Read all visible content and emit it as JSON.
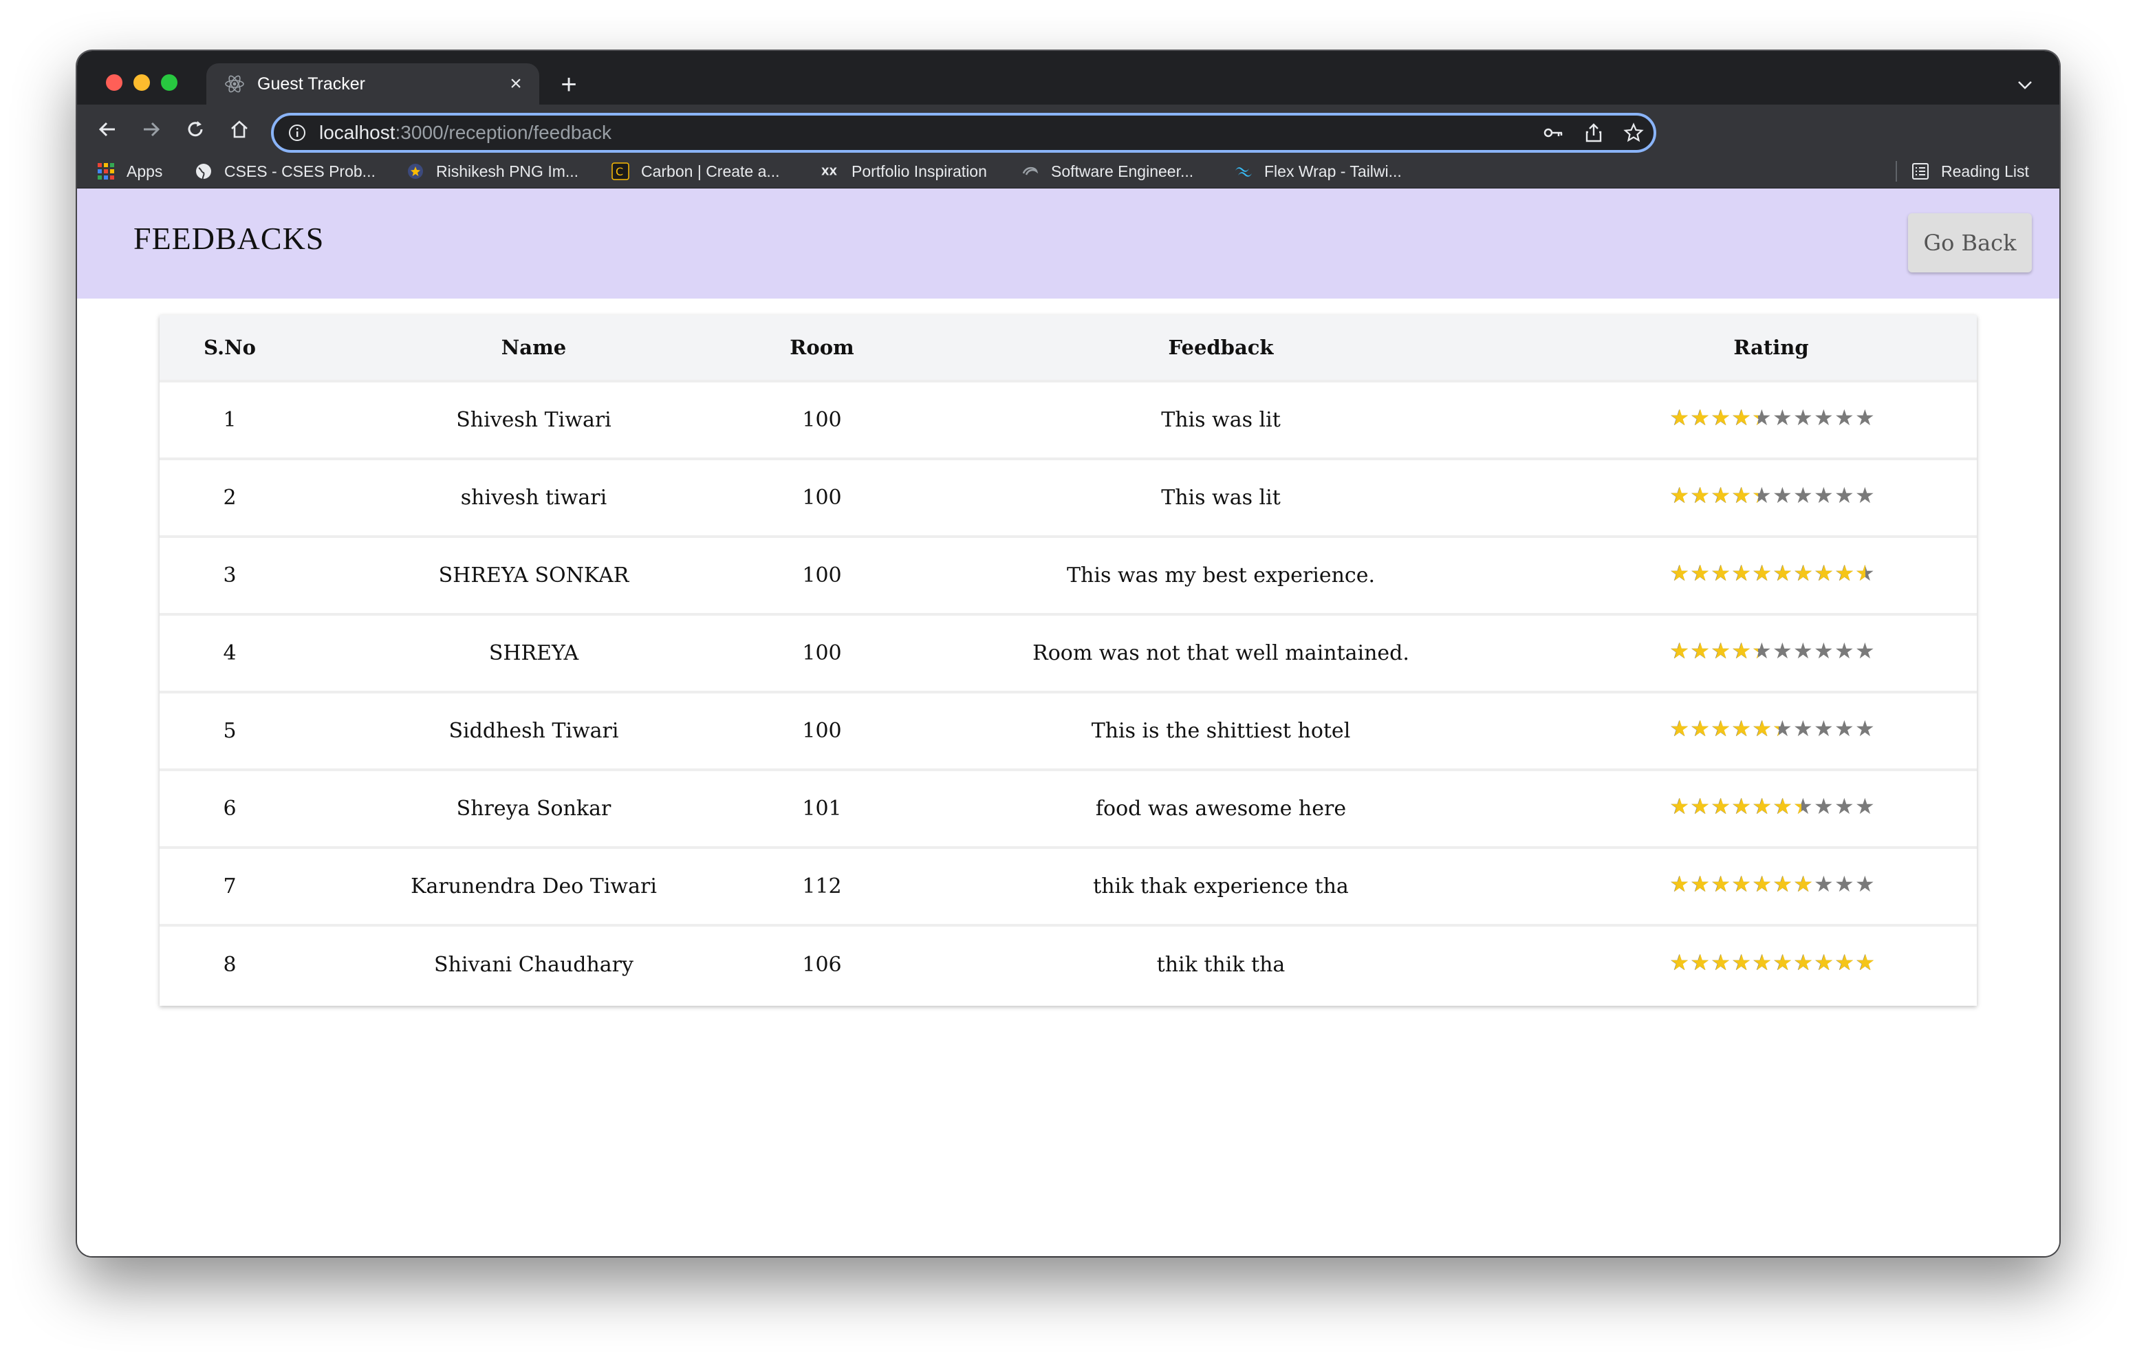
{
  "browser": {
    "tab_title": "Guest Tracker",
    "url_host": "localhost",
    "url_rest": ":3000/reception/feedback",
    "bookmarks": [
      "Apps",
      "CSES - CSES Prob...",
      "Rishikesh PNG Im...",
      "Carbon | Create a...",
      "Portfolio Inspiration",
      "Software Engineer...",
      "Flex Wrap - Tailwi..."
    ],
    "reading_list": "Reading List",
    "ext_badge": "Off"
  },
  "page": {
    "title": "FEEDBACKS",
    "go_back_label": "Go Back"
  },
  "table": {
    "headers": [
      "S.No",
      "Name",
      "Room",
      "Feedback",
      "Rating"
    ],
    "rows": [
      {
        "sno": "1",
        "name": "Shivesh Tiwari",
        "room": "100",
        "feedback": "This was lit",
        "rating": 4.3
      },
      {
        "sno": "2",
        "name": "shivesh tiwari",
        "room": "100",
        "feedback": "This was lit",
        "rating": 4.3
      },
      {
        "sno": "3",
        "name": "SHREYA SONKAR",
        "room": "100",
        "feedback": "This was my best experience.",
        "rating": 9.5
      },
      {
        "sno": "4",
        "name": "SHREYA",
        "room": "100",
        "feedback": "Room was not that well maintained.",
        "rating": 4.3
      },
      {
        "sno": "5",
        "name": "Siddhesh Tiwari",
        "room": "100",
        "feedback": "This is the shittiest hotel",
        "rating": 5.3
      },
      {
        "sno": "6",
        "name": "Shreya Sonkar",
        "room": "101",
        "feedback": "food was awesome here",
        "rating": 6.4
      },
      {
        "sno": "7",
        "name": "Karunendra Deo Tiwari",
        "room": "112",
        "feedback": "thik thak experience tha",
        "rating": 7
      },
      {
        "sno": "8",
        "name": "Shivani Chaudhary",
        "room": "106",
        "feedback": "thik thik tha",
        "rating": 10
      }
    ],
    "rating_max": 10
  },
  "colors": {
    "header_bg": "#dcd5f8",
    "star_filled": "#f5c518",
    "star_empty": "#7a7a7a",
    "omnibox_focus": "#8ab4f8"
  }
}
